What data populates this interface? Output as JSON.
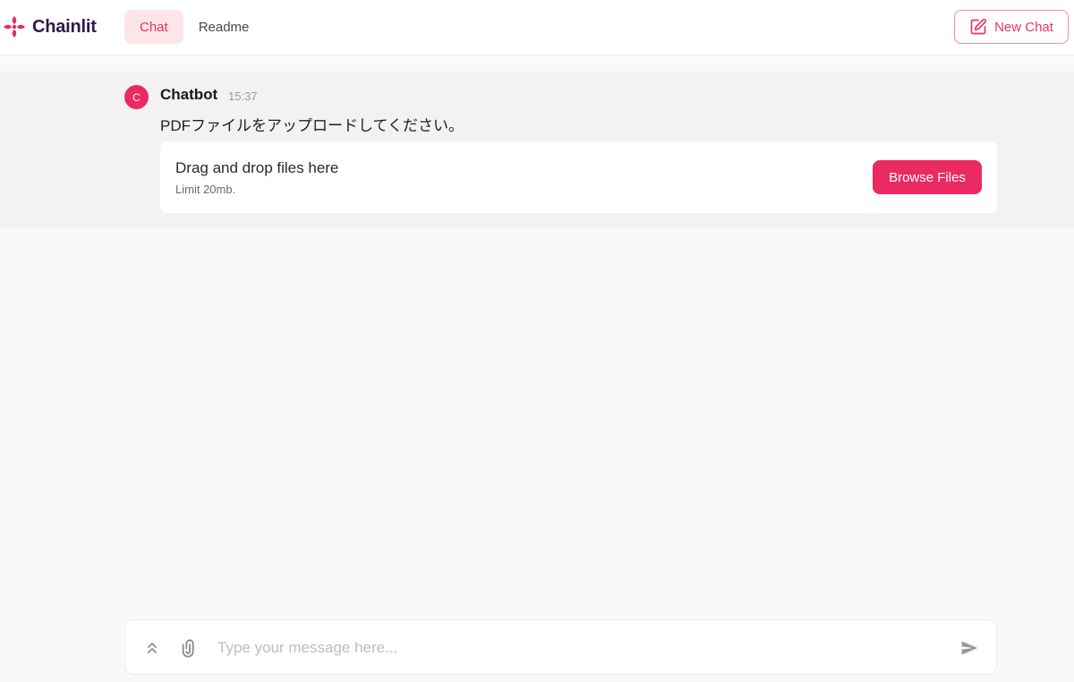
{
  "app": {
    "name": "Chainlit",
    "brand_color": "#ea2a60"
  },
  "nav": {
    "tabs": [
      {
        "label": "Chat",
        "active": true
      },
      {
        "label": "Readme",
        "active": false
      }
    ]
  },
  "header": {
    "new_chat_label": "New Chat",
    "new_chat_icon": "edit-icon"
  },
  "message": {
    "avatar_letter": "C",
    "author": "Chatbot",
    "time": "15:37",
    "text": "PDFファイルをアップロードしてください。"
  },
  "upload": {
    "title": "Drag and drop files here",
    "limit": "Limit 20mb.",
    "button_label": "Browse Files"
  },
  "composer": {
    "placeholder": "Type your message here...",
    "icons": [
      "chevrons-up-icon",
      "paperclip-icon",
      "send-icon"
    ]
  }
}
